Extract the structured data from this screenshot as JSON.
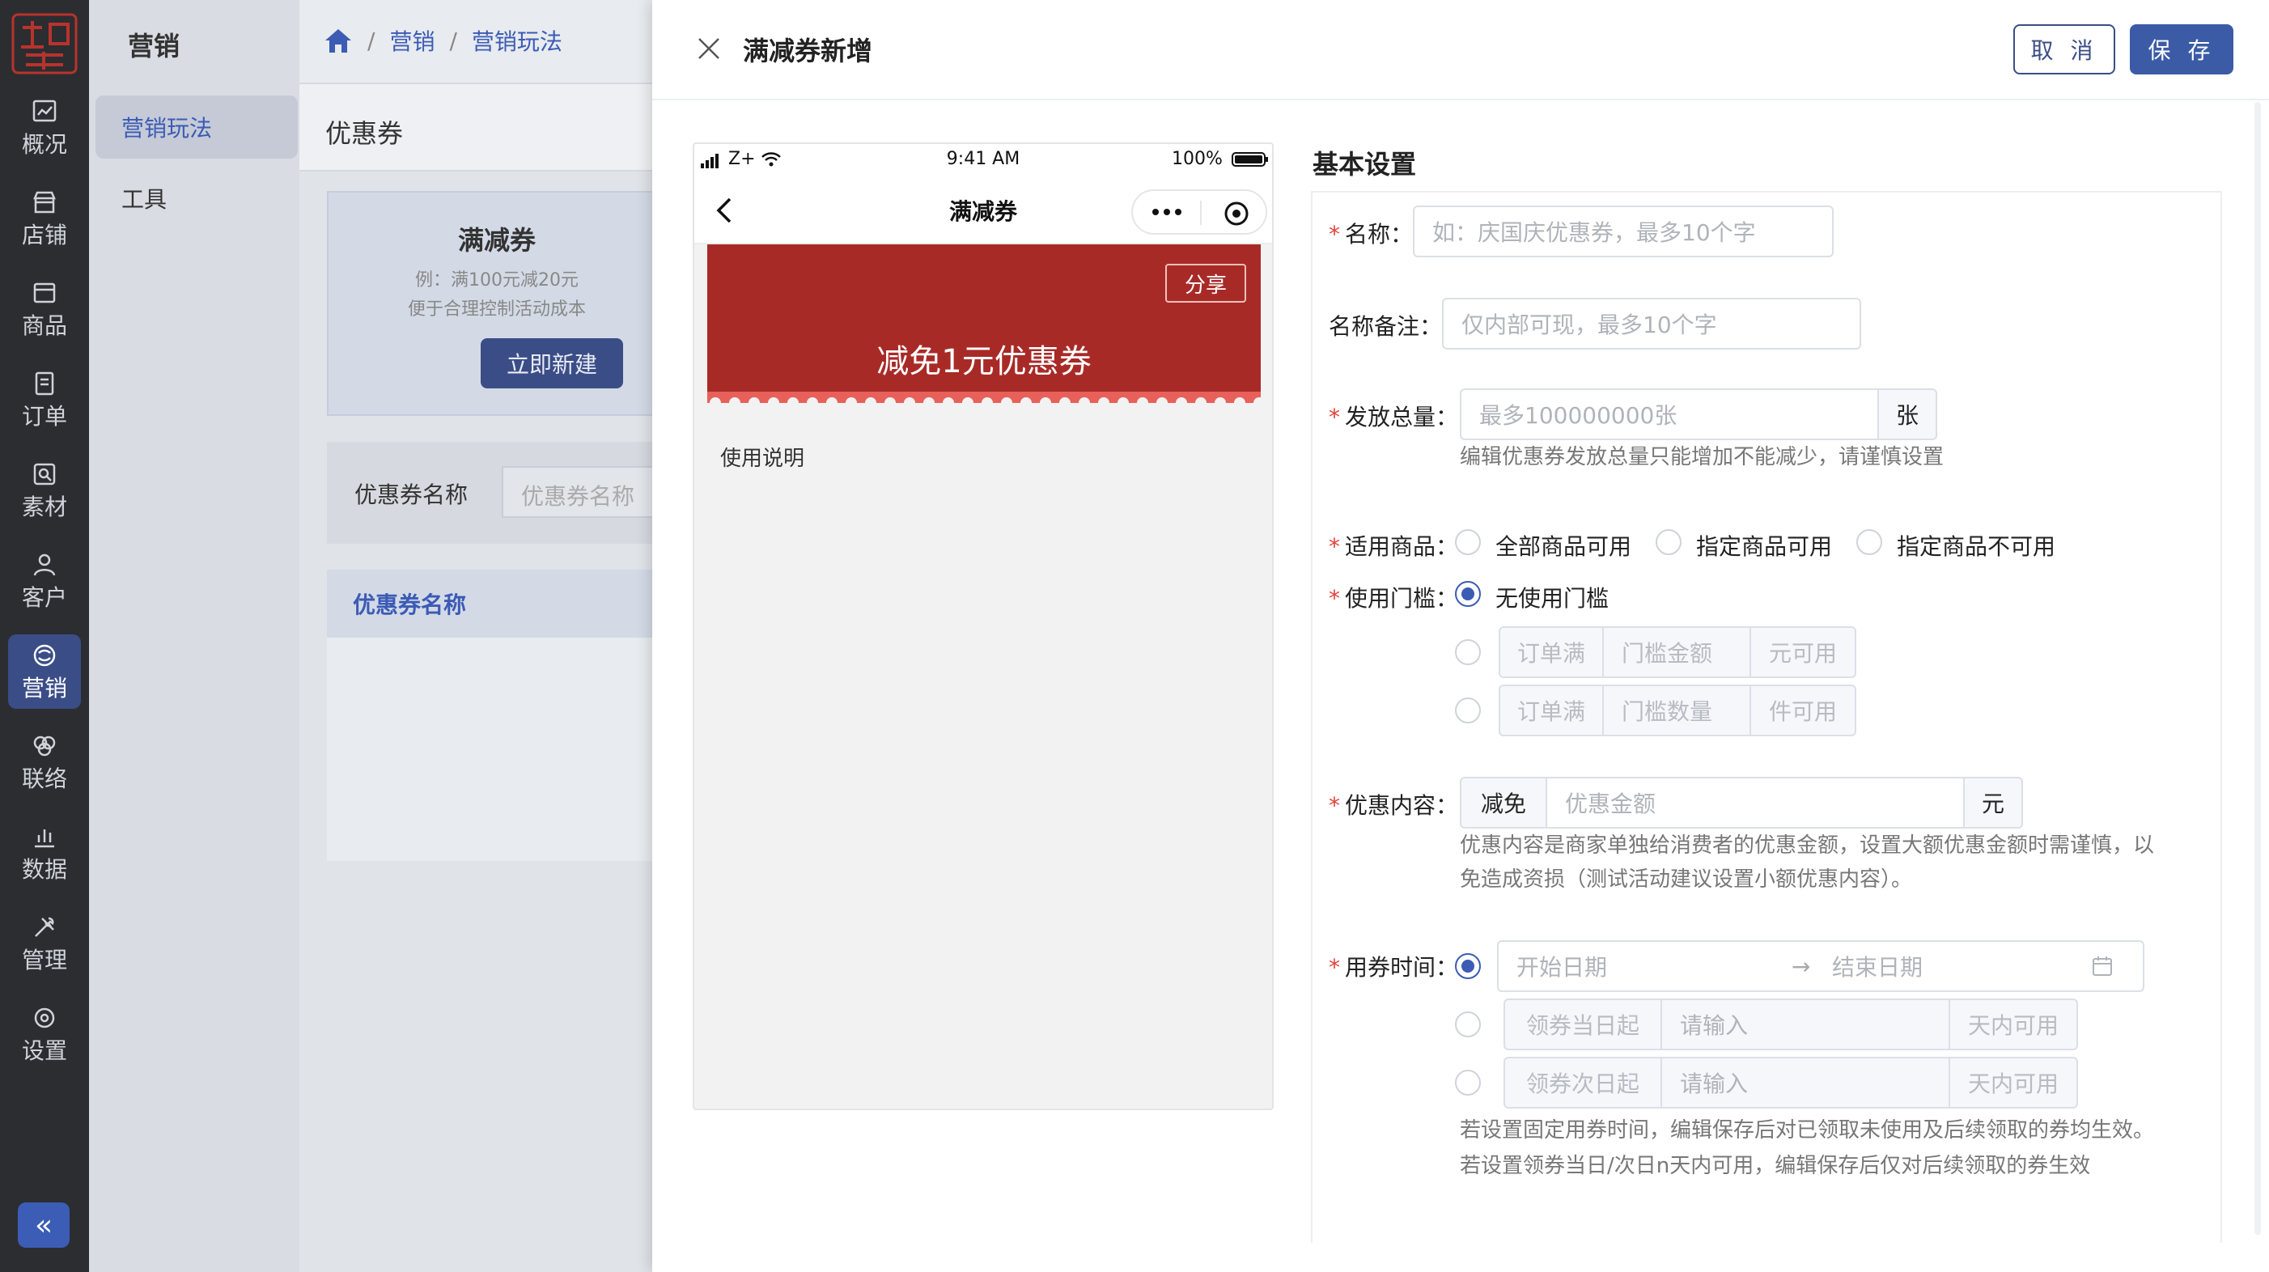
{
  "rail": {
    "logo": "logo",
    "items": [
      {
        "label": "概况",
        "icon": "chart-icon"
      },
      {
        "label": "店铺",
        "icon": "store-icon"
      },
      {
        "label": "商品",
        "icon": "product-icon"
      },
      {
        "label": "订单",
        "icon": "order-icon"
      },
      {
        "label": "素材",
        "icon": "material-icon"
      },
      {
        "label": "客户",
        "icon": "user-icon"
      },
      {
        "label": "营销",
        "icon": "marketing-icon"
      },
      {
        "label": "联络",
        "icon": "contact-icon"
      },
      {
        "label": "数据",
        "icon": "data-icon"
      },
      {
        "label": "管理",
        "icon": "tools-icon"
      },
      {
        "label": "设置",
        "icon": "settings-icon"
      }
    ],
    "active": "营销",
    "collapse_label": "«"
  },
  "subnav": {
    "title": "营销",
    "items": [
      "营销玩法",
      "工具"
    ]
  },
  "page": {
    "breadcrumb": [
      "营销",
      "营销玩法"
    ],
    "header_title": "优惠券",
    "card": {
      "title": "满减券",
      "line1": "例：满100元减20元",
      "line2": "便于合理控制活动成本",
      "button": "立即新建"
    },
    "filter": {
      "label": "优惠券名称",
      "placeholder": "优惠券名称"
    },
    "table_header": "优惠券名称"
  },
  "drawer": {
    "title": "满减券新增",
    "cancel": "取 消",
    "save": "保 存",
    "phone": {
      "time": "9:41 AM",
      "carrier": "Z+",
      "battery": "100%",
      "nav_title": "满减券",
      "coupon_amount": "减免1元优惠券",
      "share": "分享",
      "usage": "使用说明"
    },
    "form": {
      "section_title": "基本设置",
      "name_label": "名称",
      "name_placeholder": "如：庆国庆优惠券，最多10个字",
      "remark_label": "名称备注",
      "remark_placeholder": "仅内部可现，最多10个字",
      "total_label": "发放总量",
      "total_placeholder": "最多100000000张",
      "total_unit": "张",
      "total_hint": "编辑优惠券发放总量只能增加不能减少，请谨慎设置",
      "goods_label": "适用商品",
      "goods_options": [
        "全部商品可用",
        "指定商品可用",
        "指定商品不可用"
      ],
      "threshold_label": "使用门槛",
      "threshold_none": "无使用门槛",
      "threshold_amount": {
        "prefix": "订单满",
        "placeholder": "门槛金额",
        "suffix": "元可用"
      },
      "threshold_count": {
        "prefix": "订单满",
        "placeholder": "门槛数量",
        "suffix": "件可用"
      },
      "discount_label": "优惠内容",
      "discount_prefix": "减免",
      "discount_placeholder": "优惠金额",
      "discount_unit": "元",
      "discount_hint1": "优惠内容是商家单独给消费者的优惠金额，设置大额优惠金额时需谨慎，以",
      "discount_hint2": "免造成资损（测试活动建议设置小额优惠内容）。",
      "time_label": "用券时间",
      "start_placeholder": "开始日期",
      "end_placeholder": "结束日期",
      "same_day": {
        "prefix": "领券当日起",
        "placeholder": "请输入",
        "suffix": "天内可用"
      },
      "next_day": {
        "prefix": "领券次日起",
        "placeholder": "请输入",
        "suffix": "天内可用"
      },
      "time_hint1": "若设置固定用券时间，编辑保存后对已领取未使用及后续领取的券均生效。",
      "time_hint2": "若设置领券当日/次日n天内可用，编辑保存后仅对后续领取的券生效"
    }
  },
  "colors": {
    "brand": "#3b5bb5",
    "coupon": "#a82a27",
    "required": "#e0443b"
  }
}
